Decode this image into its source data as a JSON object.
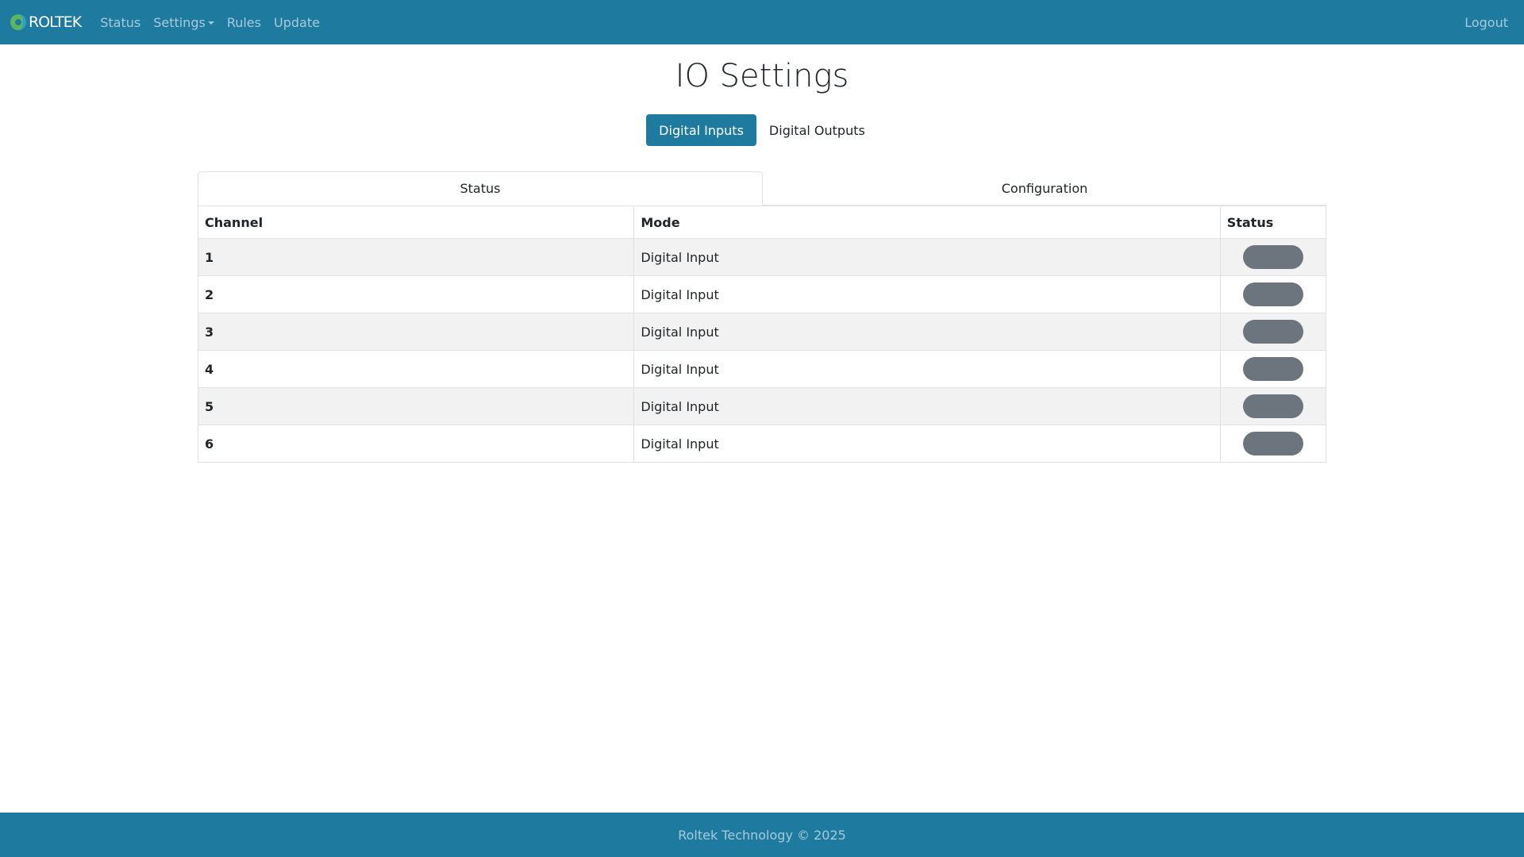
{
  "colors": {
    "brand": "#1f7aa0",
    "status_off": "#6c757d",
    "row_stripe": "#f2f2f2"
  },
  "navbar": {
    "brand": "ROLTEK",
    "brand_icon": "roltek-logo-icon",
    "links": {
      "status": "Status",
      "settings": "Settings",
      "rules": "Rules",
      "update": "Update"
    },
    "logout": "Logout"
  },
  "page": {
    "title": "IO Settings"
  },
  "pills": {
    "digital_inputs": "Digital Inputs",
    "digital_outputs": "Digital Outputs",
    "active": "Digital Inputs"
  },
  "tabs": {
    "status": "Status",
    "configuration": "Configuration",
    "active": "Status"
  },
  "table": {
    "headers": {
      "channel": "Channel",
      "mode": "Mode",
      "status": "Status"
    },
    "rows": [
      {
        "channel": "1",
        "mode": "Digital Input",
        "status": "off"
      },
      {
        "channel": "2",
        "mode": "Digital Input",
        "status": "off"
      },
      {
        "channel": "3",
        "mode": "Digital Input",
        "status": "off"
      },
      {
        "channel": "4",
        "mode": "Digital Input",
        "status": "off"
      },
      {
        "channel": "5",
        "mode": "Digital Input",
        "status": "off"
      },
      {
        "channel": "6",
        "mode": "Digital Input",
        "status": "off"
      }
    ]
  },
  "footer": {
    "text": "Roltek Technology © 2025"
  }
}
